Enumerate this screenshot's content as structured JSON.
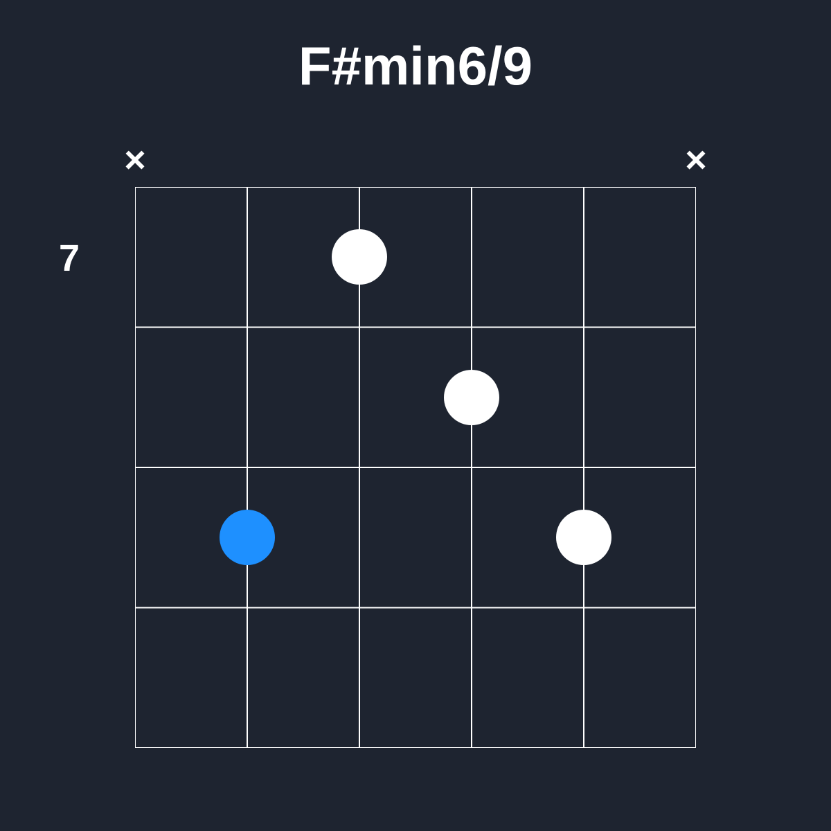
{
  "chord": {
    "name": "F#min6/9",
    "start_fret": "7",
    "num_strings": 6,
    "num_frets": 4,
    "muted_strings": [
      1,
      6
    ],
    "open_strings": [],
    "dots": [
      {
        "string": 2,
        "fret": 3,
        "root": true
      },
      {
        "string": 3,
        "fret": 1,
        "root": false
      },
      {
        "string": 4,
        "fret": 2,
        "root": false
      },
      {
        "string": 5,
        "fret": 3,
        "root": false
      }
    ],
    "colors": {
      "background": "#1e2430",
      "grid": "#ffffff",
      "dot": "#ffffff",
      "root_dot": "#1e90ff",
      "text": "#ffffff"
    },
    "mute_symbol": "×"
  }
}
